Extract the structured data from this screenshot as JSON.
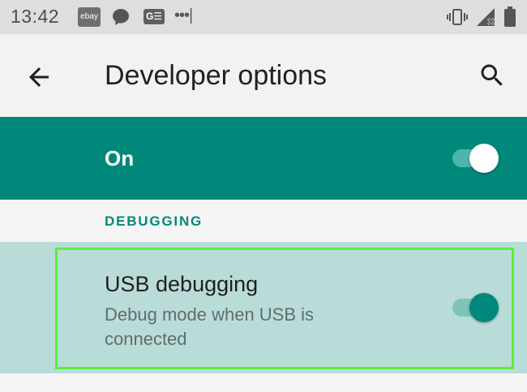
{
  "status_bar": {
    "time": "13:42",
    "ebay_label": "ebay",
    "gmail_label": "G☰",
    "more_dots": "•••|",
    "icons": [
      "ebay-icon",
      "message-icon",
      "news-icon",
      "more-notifications-icon",
      "vibrate-icon",
      "signal-icon",
      "battery-icon"
    ]
  },
  "toolbar": {
    "title": "Developer options",
    "back_icon": "arrow-back-icon",
    "search_icon": "search-icon"
  },
  "master_switch": {
    "label": "On",
    "state": "on"
  },
  "section": {
    "label": "DEBUGGING"
  },
  "usb_debugging": {
    "title": "USB debugging",
    "summary": "Debug mode when USB is connected",
    "state": "on",
    "highlighted": true
  },
  "colors": {
    "accent": "#00897b",
    "status_bar_bg": "#dedede",
    "highlight_border": "#57f238",
    "row_selected_bg": "#b9dcd8"
  }
}
